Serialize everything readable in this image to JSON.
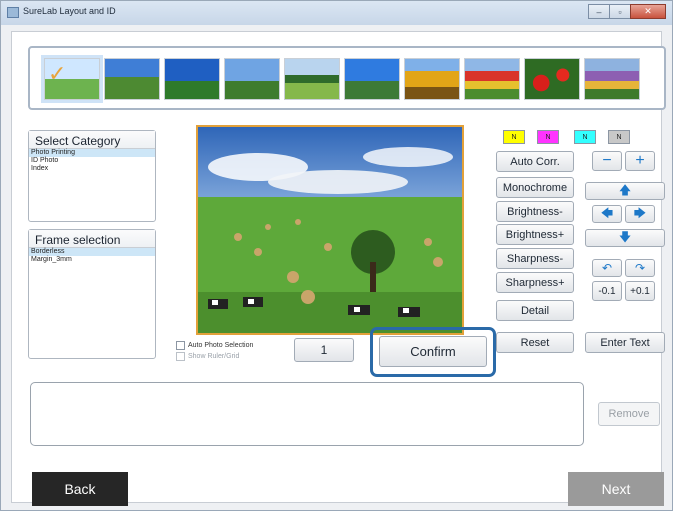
{
  "window": {
    "title": "SureLab Layout and ID",
    "minimize_glyph": "–",
    "maximize_glyph": "▫",
    "close_glyph": "✕"
  },
  "thumbnails": [
    {
      "icon": "photo-hay-meadow"
    },
    {
      "icon": "photo-grassland"
    },
    {
      "icon": "photo-blue-sky"
    },
    {
      "icon": "photo-cloudy-sky"
    },
    {
      "icon": "photo-tree-row"
    },
    {
      "icon": "photo-road-sky"
    },
    {
      "icon": "photo-sunflowers"
    },
    {
      "icon": "photo-tulip-rows"
    },
    {
      "icon": "photo-red-poppies"
    },
    {
      "icon": "photo-flower-field"
    }
  ],
  "selected_thumbnail_check": "✓",
  "category": {
    "header": "Select Category",
    "items": [
      "Photo Printing",
      "ID Photo",
      "Index"
    ]
  },
  "frame": {
    "header": "Frame selection",
    "items": [
      "Borderless",
      "Margin_3mm"
    ]
  },
  "options": {
    "auto_photo_selection": "Auto Photo Selection",
    "show_ruler_grid": "Show Ruler/Grid"
  },
  "copies": "1",
  "confirm_label": "Confirm",
  "color_chips": [
    {
      "label": "N",
      "color": "#ffff00"
    },
    {
      "label": "N",
      "color": "#ff33ff"
    },
    {
      "label": "N",
      "color": "#33ffff"
    },
    {
      "label": "N",
      "color": "#c8c8c8"
    }
  ],
  "adjust": {
    "auto_corr": "Auto Corr.",
    "monochrome": "Monochrome",
    "brightness_minus": "Brightness-",
    "brightness_plus": "Brightness+",
    "sharpness_minus": "Sharpness-",
    "sharpness_plus": "Sharpness+",
    "detail": "Detail",
    "reset": "Reset",
    "enter_text": "Enter Text"
  },
  "zoom": {
    "out": "−",
    "in": "+"
  },
  "move": {
    "up": "🡅",
    "left": "🡄",
    "right": "🡆",
    "down": "🡇"
  },
  "rotate": {
    "minus": "-0.1",
    "plus": "+0.1",
    "ccw": "↶",
    "cw": "↷"
  },
  "remove_label": "Remove",
  "back_label": "Back",
  "next_label": "Next"
}
